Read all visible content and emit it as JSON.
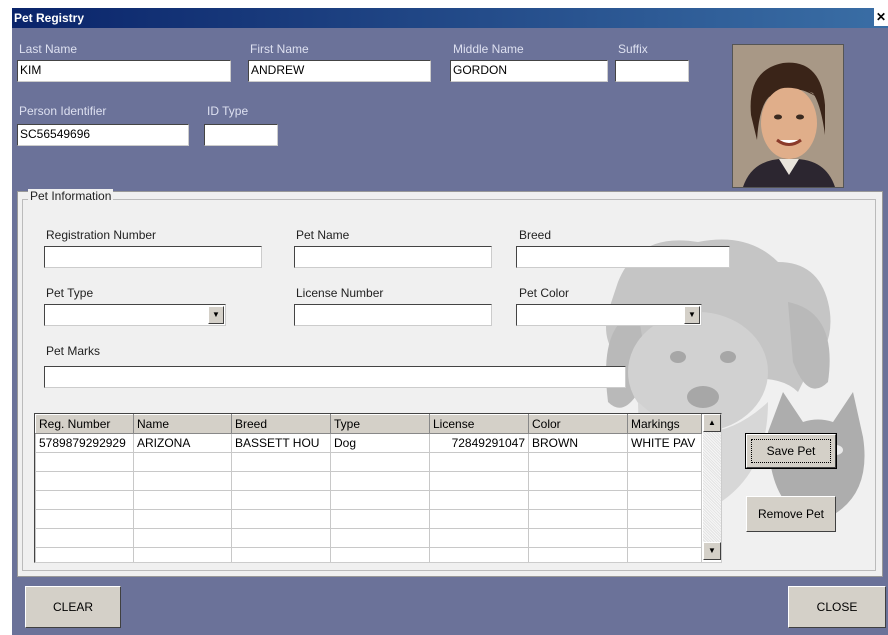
{
  "window": {
    "title": "Pet Registry",
    "close_glyph": "✕"
  },
  "person": {
    "last_name_label": "Last Name",
    "first_name_label": "First Name",
    "middle_name_label": "Middle Name",
    "suffix_label": "Suffix",
    "last_name": "KIM",
    "first_name": "ANDREW",
    "middle_name": "GORDON",
    "suffix": "",
    "person_identifier_label": "Person Identifier",
    "id_type_label": "ID Type",
    "person_identifier": "SC56549696",
    "id_type": ""
  },
  "pet_info": {
    "group_label": "Pet Information",
    "registration_number_label": "Registration Number",
    "pet_name_label": "Pet Name",
    "breed_label": "Breed",
    "pet_type_label": "Pet Type",
    "license_number_label": "License Number",
    "pet_color_label": "Pet Color",
    "pet_marks_label": "Pet Marks",
    "registration_number": "",
    "pet_name": "",
    "breed": "",
    "pet_type": "",
    "license_number": "",
    "pet_color": "",
    "pet_marks": ""
  },
  "grid": {
    "headers": [
      "Reg. Number",
      "Name",
      "Breed",
      "Type",
      "License",
      "Color",
      "Markings"
    ],
    "rows": [
      [
        "5789879292929",
        "ARIZONA",
        "BASSETT HOU",
        "Dog",
        "72849291047",
        "BROWN",
        "WHITE PAV"
      ]
    ]
  },
  "buttons": {
    "save_pet": "Save Pet",
    "remove_pet": "Remove Pet",
    "clear": "CLEAR",
    "close": "CLOSE"
  },
  "icons": {
    "dropdown": "arrow-down-icon",
    "scroll_up": "arrow-up-icon",
    "scroll_down": "arrow-down-icon"
  }
}
